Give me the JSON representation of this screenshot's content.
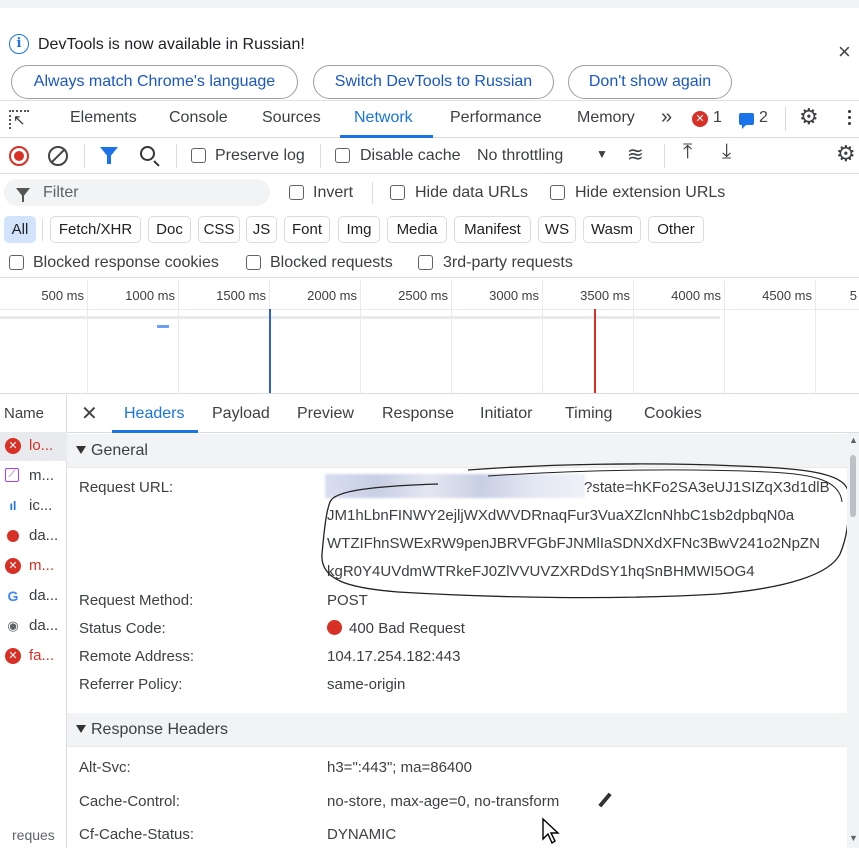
{
  "infobar": {
    "message": "DevTools is now available in Russian!",
    "buttons": [
      "Always match Chrome's language",
      "Switch DevTools to Russian",
      "Don't show again"
    ],
    "close": "×"
  },
  "tabs": {
    "items": [
      "Elements",
      "Console",
      "Sources",
      "Network",
      "Performance",
      "Memory"
    ],
    "active": "Network",
    "more": "»",
    "errors": "1",
    "messages": "2"
  },
  "toolbar": {
    "preserve_log": "Preserve log",
    "disable_cache": "Disable cache",
    "throttling": "No throttling"
  },
  "filter": {
    "placeholder": "Filter",
    "invert": "Invert",
    "hide_data_urls": "Hide data URLs",
    "hide_extension_urls": "Hide extension URLs"
  },
  "type_chips": [
    "All",
    "Fetch/XHR",
    "Doc",
    "CSS",
    "JS",
    "Font",
    "Img",
    "Media",
    "Manifest",
    "WS",
    "Wasm",
    "Other"
  ],
  "block_options": [
    "Blocked response cookies",
    "Blocked requests",
    "3rd-party requests"
  ],
  "timeline": {
    "ticks": [
      "500 ms",
      "1000 ms",
      "1500 ms",
      "2000 ms",
      "2500 ms",
      "3000 ms",
      "3500 ms",
      "4000 ms",
      "4500 ms",
      "5"
    ]
  },
  "requests": {
    "header": "Name",
    "items": [
      {
        "name": "lo...",
        "icon": "error-icon",
        "color": "#d93025"
      },
      {
        "name": "m...",
        "icon": "image-icon",
        "color": "#3c4043"
      },
      {
        "name": "ic...",
        "icon": "chart-icon",
        "color": "#3c4043"
      },
      {
        "name": "da...",
        "icon": "pin-icon",
        "color": "#3c4043"
      },
      {
        "name": "m...",
        "icon": "error-icon",
        "color": "#d93025"
      },
      {
        "name": "da...",
        "icon": "google-icon",
        "color": "#3c4043"
      },
      {
        "name": "da...",
        "icon": "eye-icon",
        "color": "#3c4043"
      },
      {
        "name": "fa...",
        "icon": "error-icon",
        "color": "#d93025"
      }
    ],
    "footer": "reques"
  },
  "detail_tabs": {
    "items": [
      "Headers",
      "Payload",
      "Preview",
      "Response",
      "Initiator",
      "Timing",
      "Cookies"
    ],
    "active": "Headers"
  },
  "general": {
    "title": "General",
    "request_url_label": "Request URL:",
    "request_url_lines": [
      "?state=hKFo2SA3eUJ1SIZqX3d1dlB",
      "JM1hLbnFINWY2ejljWXdWVDRnaqFur3VuaXZlcnNhbC1sb2dpbqN0a",
      "WTZIFhnSWExRW9penJBRVFGbFJNMlIaSDNXdXFNc3BwV241o2NpZN",
      "kgR0Y4UVdmWTRkeFJ0ZlVVUVZXRDdSY1hqSnBHMWI5OG4"
    ],
    "request_method_label": "Request Method:",
    "request_method": "POST",
    "status_code_label": "Status Code:",
    "status_code": "400 Bad Request",
    "remote_address_label": "Remote Address:",
    "remote_address": "104.17.254.182:443",
    "referrer_policy_label": "Referrer Policy:",
    "referrer_policy": "same-origin"
  },
  "response_headers": {
    "title": "Response Headers",
    "alt_svc_label": "Alt-Svc:",
    "alt_svc": "h3=\":443\"; ma=86400",
    "cache_control_label": "Cache-Control:",
    "cache_control": "no-store, max-age=0, no-transform",
    "cf_cache_status_label": "Cf-Cache-Status:",
    "cf_cache_status": "DYNAMIC"
  },
  "colors": {
    "accent": "#1a73e8",
    "error": "#d93025"
  }
}
